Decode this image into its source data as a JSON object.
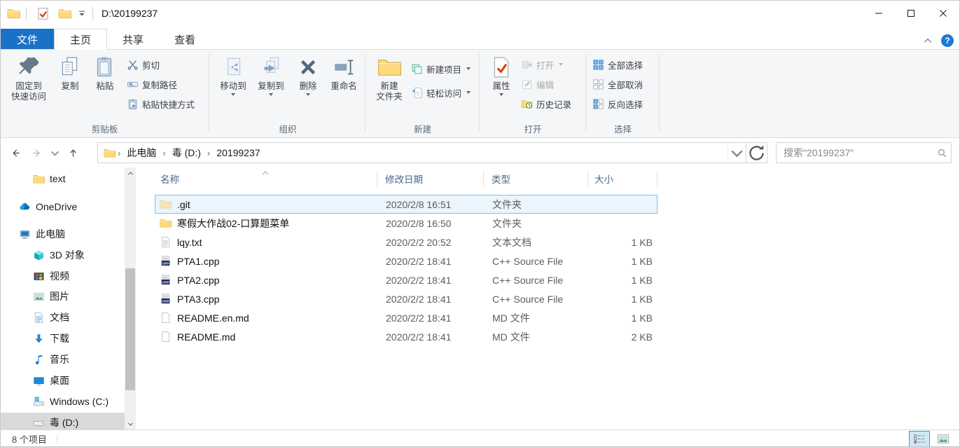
{
  "titlebar": {
    "path_title": "D:\\20199237"
  },
  "tabs": {
    "file": "文件",
    "home": "主页",
    "share": "共享",
    "view": "查看"
  },
  "ribbon": {
    "clipboard": {
      "label": "剪贴板",
      "pin_line1": "固定到",
      "pin_line2": "快速访问",
      "copy": "复制",
      "paste": "粘贴",
      "cut": "剪切",
      "copy_path": "复制路径",
      "paste_shortcut": "粘贴快捷方式"
    },
    "organize": {
      "label": "组织",
      "move_to": "移动到",
      "copy_to": "复制到",
      "delete": "删除",
      "rename": "重命名"
    },
    "create": {
      "label": "新建",
      "new_folder_line1": "新建",
      "new_folder_line2": "文件夹",
      "new_item": "新建项目",
      "easy_access": "轻松访问"
    },
    "open": {
      "label": "打开",
      "properties": "属性",
      "open": "打开",
      "edit": "编辑",
      "history": "历史记录"
    },
    "select": {
      "label": "选择",
      "select_all": "全部选择",
      "select_none": "全部取消",
      "invert_selection": "反向选择"
    }
  },
  "navbar": {
    "breadcrumb": [
      "此电脑",
      "毒 (D:)",
      "20199237"
    ],
    "search_placeholder": "搜索\"20199237\""
  },
  "sidebar": {
    "items": [
      {
        "label": "text",
        "icon": "folder",
        "indent": 2,
        "selected": false
      },
      {
        "label": "OneDrive",
        "icon": "cloud",
        "indent": 1,
        "selected": false
      },
      {
        "label": "此电脑",
        "icon": "computer",
        "indent": 1,
        "selected": false
      },
      {
        "label": "3D 对象",
        "icon": "cube",
        "indent": 2,
        "selected": false
      },
      {
        "label": "视频",
        "icon": "film",
        "indent": 2,
        "selected": false
      },
      {
        "label": "图片",
        "icon": "picture",
        "indent": 2,
        "selected": false
      },
      {
        "label": "文档",
        "icon": "doc",
        "indent": 2,
        "selected": false
      },
      {
        "label": "下载",
        "icon": "download",
        "indent": 2,
        "selected": false
      },
      {
        "label": "音乐",
        "icon": "music",
        "indent": 2,
        "selected": false
      },
      {
        "label": "桌面",
        "icon": "desktop",
        "indent": 2,
        "selected": false
      },
      {
        "label": "Windows (C:)",
        "icon": "drive-win",
        "indent": 2,
        "selected": false
      },
      {
        "label": "毒 (D:)",
        "icon": "drive",
        "indent": 2,
        "selected": true
      }
    ]
  },
  "filelist": {
    "columns": {
      "name": "名称",
      "date": "修改日期",
      "type": "类型",
      "size": "大小"
    },
    "rows": [
      {
        "name": ".git",
        "icon": "folder-pale",
        "date": "2020/2/8 16:51",
        "type": "文件夹",
        "size": "",
        "selected": true
      },
      {
        "name": "寒假大作战02-口算题菜单",
        "icon": "folder",
        "date": "2020/2/8 16:50",
        "type": "文件夹",
        "size": "",
        "selected": false
      },
      {
        "name": "lqy.txt",
        "icon": "text-doc",
        "date": "2020/2/2 20:52",
        "type": "文本文档",
        "size": "1 KB",
        "selected": false
      },
      {
        "name": "PTA1.cpp",
        "icon": "cpp",
        "date": "2020/2/2 18:41",
        "type": "C++ Source File",
        "size": "1 KB",
        "selected": false
      },
      {
        "name": "PTA2.cpp",
        "icon": "cpp",
        "date": "2020/2/2 18:41",
        "type": "C++ Source File",
        "size": "1 KB",
        "selected": false
      },
      {
        "name": "PTA3.cpp",
        "icon": "cpp",
        "date": "2020/2/2 18:41",
        "type": "C++ Source File",
        "size": "1 KB",
        "selected": false
      },
      {
        "name": "README.en.md",
        "icon": "md-doc",
        "date": "2020/2/2 18:41",
        "type": "MD 文件",
        "size": "1 KB",
        "selected": false
      },
      {
        "name": "README.md",
        "icon": "md-doc",
        "date": "2020/2/2 18:41",
        "type": "MD 文件",
        "size": "2 KB",
        "selected": false
      }
    ]
  },
  "statusbar": {
    "item_count": "8 个项目"
  },
  "colors": {
    "accent_blue": "#1a72c8",
    "selection_border": "#7cc1f0",
    "selection_fill": "#eaf5fd",
    "sidebar_selected": "#d9d9d9"
  }
}
